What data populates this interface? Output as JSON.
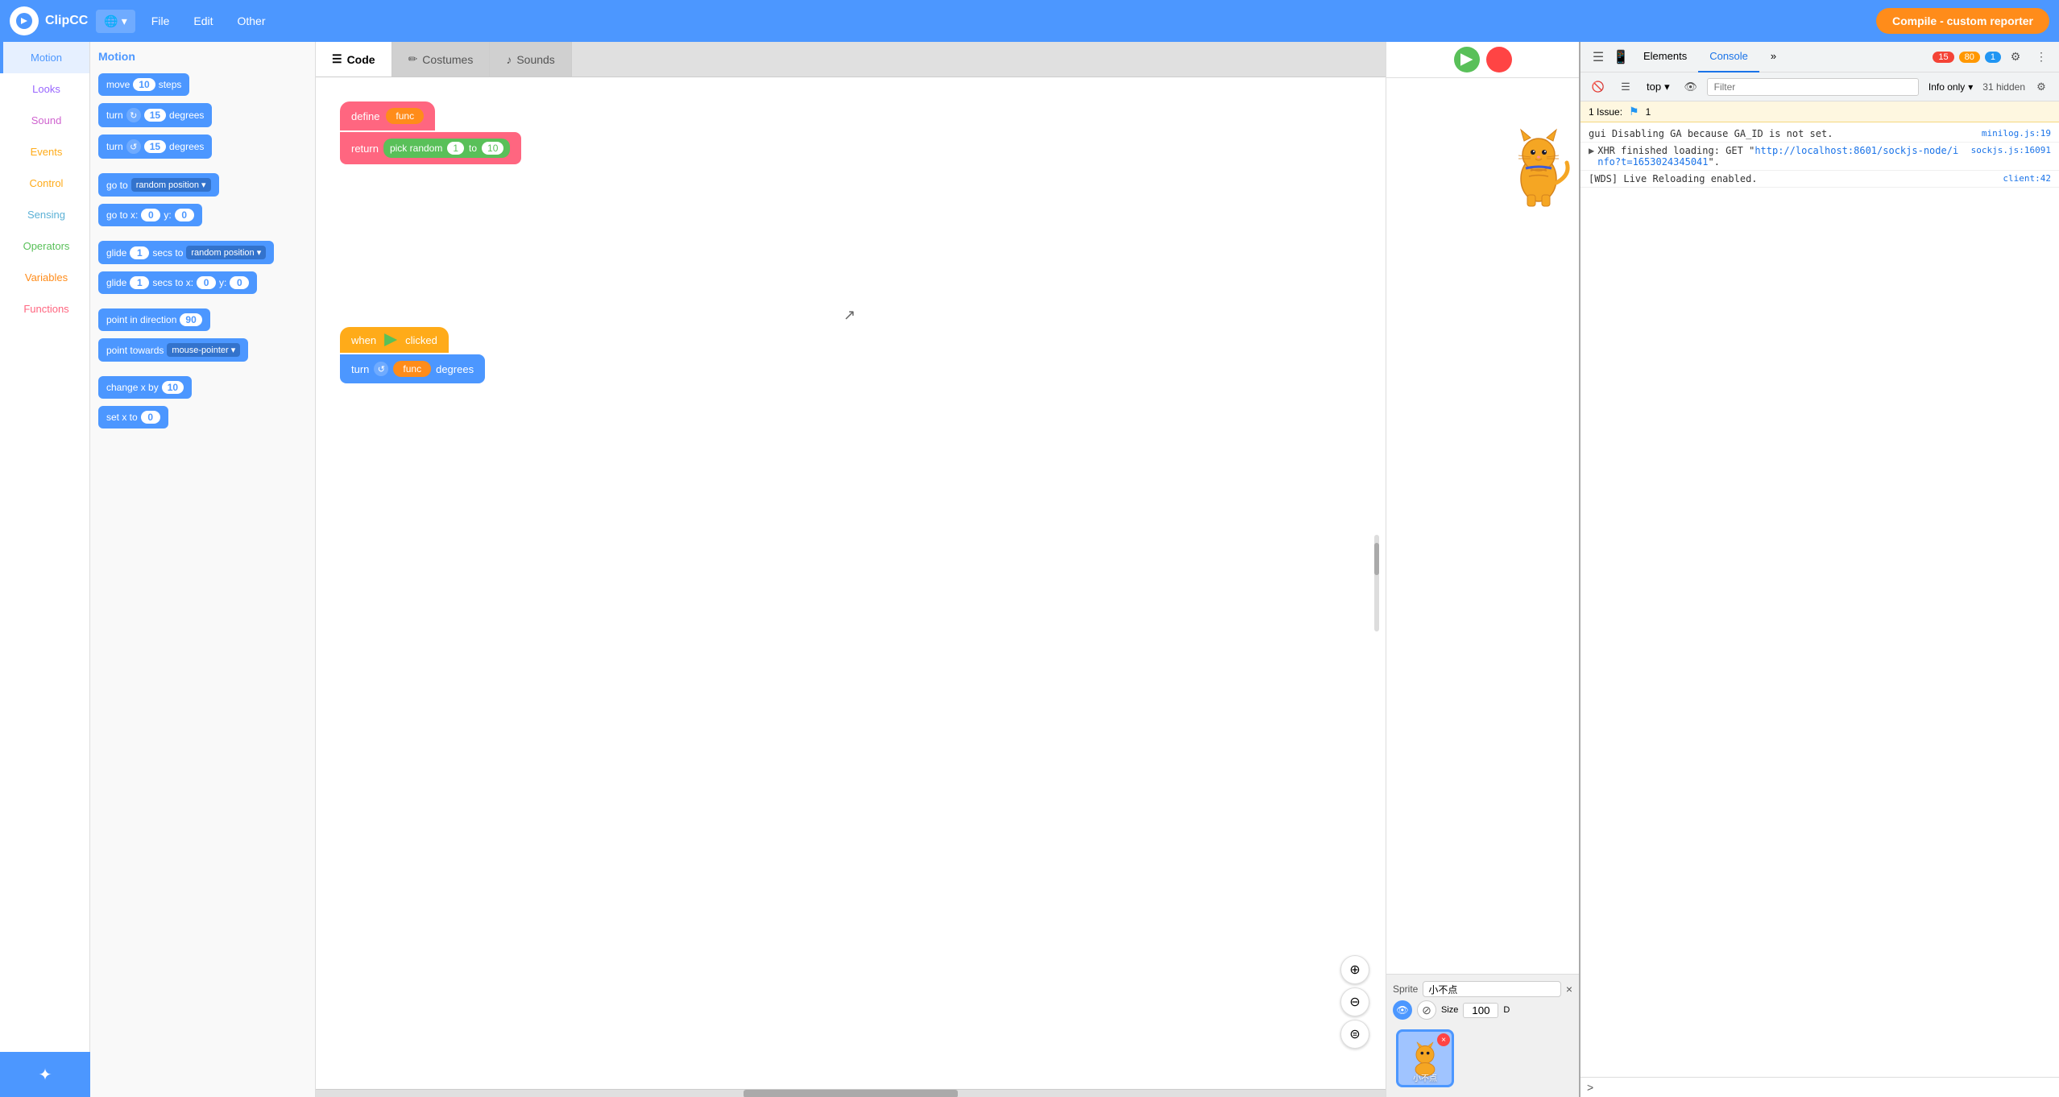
{
  "topbar": {
    "logo": "ClipCC",
    "globe_label": "🌐",
    "file_label": "File",
    "edit_label": "Edit",
    "other_label": "Other",
    "compile_label": "Compile - custom reporter"
  },
  "tabs": {
    "code_label": "Code",
    "costumes_label": "Costumes",
    "sounds_label": "Sounds"
  },
  "categories": [
    {
      "id": "motion",
      "label": "Motion",
      "color": "#4c97ff"
    },
    {
      "id": "looks",
      "label": "Looks",
      "color": "#9966ff"
    },
    {
      "id": "sound",
      "label": "Sound",
      "color": "#cf63cf"
    },
    {
      "id": "events",
      "label": "Events",
      "color": "#ffab19"
    },
    {
      "id": "control",
      "label": "Control",
      "color": "#ffab19"
    },
    {
      "id": "sensing",
      "label": "Sensing",
      "color": "#5cb1d6"
    },
    {
      "id": "operators",
      "label": "Operators",
      "color": "#59c059"
    },
    {
      "id": "variables",
      "label": "Variables",
      "color": "#ff8c1a"
    },
    {
      "id": "functions",
      "label": "Functions",
      "color": "#ff6680"
    }
  ],
  "blocks_title": "Motion",
  "blocks": [
    {
      "id": "move-steps",
      "text": "move",
      "val": "10",
      "suffix": "steps"
    },
    {
      "id": "turn-cw",
      "text": "turn ↻",
      "val": "15",
      "suffix": "degrees"
    },
    {
      "id": "turn-ccw",
      "text": "turn ↺",
      "val": "15",
      "suffix": "degrees"
    },
    {
      "id": "goto-random",
      "text": "go to",
      "dropdown": "random position"
    },
    {
      "id": "goto-xy",
      "text": "go to x:",
      "val1": "0",
      "text2": "y:",
      "val2": "0"
    },
    {
      "id": "glide-random",
      "text": "glide",
      "val": "1",
      "suffix": "secs to",
      "dropdown": "random position"
    },
    {
      "id": "glide-xy",
      "text": "glide",
      "val": "1",
      "suffix": "secs to x:",
      "val2": "0",
      "text2": "y:",
      "val3": "0"
    },
    {
      "id": "point-dir",
      "text": "point in direction",
      "val": "90"
    },
    {
      "id": "point-towards",
      "text": "point towards",
      "dropdown": "mouse-pointer"
    },
    {
      "id": "change-x",
      "text": "change x by",
      "val": "10"
    },
    {
      "id": "set-x",
      "text": "set x to",
      "val": "0"
    }
  ],
  "canvas_blocks": {
    "stack1": {
      "define_label": "define",
      "func_label": "func",
      "return_label": "return",
      "pick_random_label": "pick random",
      "from_val": "1",
      "to_label": "to",
      "to_val": "10"
    },
    "stack2": {
      "when_label": "when",
      "clicked_label": "clicked",
      "turn_label": "turn",
      "func_label": "func",
      "degrees_label": "degrees"
    }
  },
  "stage": {
    "green_flag": "▶",
    "stop": "⏹",
    "sprite_label": "Sprite",
    "sprite_name": "小不点",
    "size_label": "Size",
    "size_val": "100",
    "direction_label": "D"
  },
  "sprite": {
    "name": "小不点",
    "x_icon": "×"
  },
  "devtools": {
    "tabs": [
      "Elements",
      "Console"
    ],
    "more_tabs_icon": "»",
    "badges": {
      "errors": "15",
      "warnings": "80",
      "info": "1"
    },
    "settings_icon": "⚙",
    "more_icon": "⋮",
    "toolbar": {
      "clear_icon": "🚫",
      "top_label": "top",
      "eye_icon": "👁",
      "filter_placeholder": "Filter",
      "info_label": "Info only",
      "hidden_count": "31 hidden",
      "settings_icon": "⚙"
    },
    "issue_text": "1 Issue:",
    "issue_flag": "⚑",
    "issue_count": "1",
    "logs": [
      {
        "id": "gui-log",
        "msg": "gui Disabling GA because GA_ID is not set.",
        "source": "minilog.js:19"
      },
      {
        "id": "xhr-log",
        "toggle": "▶",
        "msg": "XHR finished loading: GET \"http://localhost:8601/sockjs-node/info?t=1653024345041\".",
        "source": "sockjs.js:16091"
      },
      {
        "id": "wds-log",
        "msg": "[WDS] Live Reloading enabled.",
        "source": "client:42"
      }
    ],
    "cursor_chevron": ">"
  }
}
